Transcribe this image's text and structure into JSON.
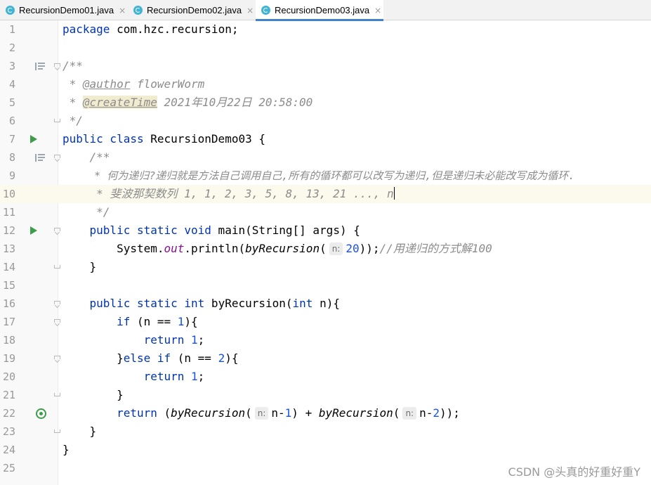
{
  "tabs": [
    {
      "label": "RecursionDemo01.java",
      "close": "×"
    },
    {
      "label": "RecursionDemo02.java",
      "close": "×"
    },
    {
      "label": "RecursionDemo03.java",
      "close": "×"
    }
  ],
  "lines": [
    {
      "n": "1",
      "t1": "package",
      "t2": " com.hzc.recursion;"
    },
    {
      "n": "2"
    },
    {
      "n": "3",
      "t1": "/**"
    },
    {
      "n": "4",
      "t1": " * ",
      "t2": "@author",
      "t3": " flowerWorm"
    },
    {
      "n": "5",
      "t1": " * ",
      "t2": "@createTime",
      "t3": " 2021年10月22日 20:58:00"
    },
    {
      "n": "6",
      "t1": " */"
    },
    {
      "n": "7",
      "t1": "public class",
      "t2": " RecursionDemo03 {"
    },
    {
      "n": "8",
      "t1": "    /**"
    },
    {
      "n": "9",
      "t1": "     * 何为递归?递归就是方法自己调用自己,所有的循环都可以改写为递归,但是递归未必能改写成为循环."
    },
    {
      "n": "10",
      "t1": "     * 斐波那契数列 1, 1, 2, 3, 5, 8, 13, 21 ..., n"
    },
    {
      "n": "11",
      "t1": "     */"
    },
    {
      "n": "12",
      "t0": "    ",
      "t1": "public static void",
      "t2": " main(String[] args) {"
    },
    {
      "n": "13",
      "t0": "        System.",
      "t1": "out",
      "t2": ".println(",
      "t3": "byRecursion",
      "t4": "(",
      "hint": "n:",
      "t5": "20",
      "t6": "));",
      "t7": "//用递归的方式解100"
    },
    {
      "n": "14",
      "t1": "    }"
    },
    {
      "n": "15"
    },
    {
      "n": "16",
      "t0": "    ",
      "t1": "public static int",
      "t2": " byRecursion(",
      "t3": "int",
      "t4": " n){"
    },
    {
      "n": "17",
      "t0": "        ",
      "t1": "if",
      "t2": " (n == ",
      "t3": "1",
      "t4": "){"
    },
    {
      "n": "18",
      "t0": "            ",
      "t1": "return",
      "t2": " ",
      "t3": "1",
      "t4": ";"
    },
    {
      "n": "19",
      "t0": "        }",
      "t1": "else if",
      "t2": " (n == ",
      "t3": "2",
      "t4": "){"
    },
    {
      "n": "20",
      "t0": "            ",
      "t1": "return",
      "t2": " ",
      "t3": "1",
      "t4": ";"
    },
    {
      "n": "21",
      "t1": "        }"
    },
    {
      "n": "22",
      "t0": "        ",
      "t1": "return",
      "t2": " (",
      "t3": "byRecursion",
      "t4": "(",
      "hint": "n:",
      "t5": "n-",
      "t6": "1",
      "t7": ") + ",
      "t8": "byRecursion",
      "t9": "(",
      "hint2": "n:",
      "t10": "n-",
      "t11": "2",
      "t12": "));"
    },
    {
      "n": "23",
      "t1": "    }"
    },
    {
      "n": "24",
      "t1": "}"
    },
    {
      "n": "25"
    }
  ],
  "watermark": "CSDN @头真的好重好重Y",
  "colors": {
    "keyword": "#0033b3",
    "number": "#1750eb",
    "comment": "#8c8c8c",
    "field": "#871094",
    "tab_accent": "#4083c9"
  }
}
